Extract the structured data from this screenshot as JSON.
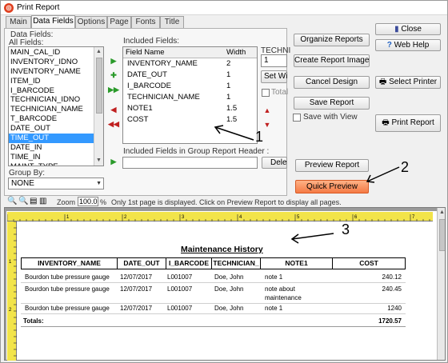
{
  "window": {
    "title": "Print Report"
  },
  "tabs": [
    {
      "label": "Main"
    },
    {
      "label": "Data Fields"
    },
    {
      "label": "Options"
    },
    {
      "label": "Page"
    },
    {
      "label": "Fonts"
    },
    {
      "label": "Title"
    }
  ],
  "data_fields": {
    "group_label": "Data Fields:",
    "all_fields_label": "All Fields:",
    "all_fields": [
      "MAIN_CAL_ID",
      "INVENTORY_IDNO",
      "INVENTORY_NAME",
      "ITEM_ID",
      "I_BARCODE",
      "TECHNICIAN_IDNO",
      "TECHNICIAN_NAME",
      "T_BARCODE",
      "DATE_OUT",
      "TIME_OUT",
      "DATE_IN",
      "TIME_IN",
      "MAINT_TYPE"
    ],
    "selected_field": "TIME_OUT",
    "included_fields_label": "Included Fields:",
    "included_columns": [
      "Field Name",
      "Width"
    ],
    "included_fields": [
      {
        "name": "INVENTORY_NAME",
        "width": "2"
      },
      {
        "name": "DATE_OUT",
        "width": "1"
      },
      {
        "name": "I_BARCODE",
        "width": "1"
      },
      {
        "name": "TECHNICIAN_NAME",
        "width": "1"
      },
      {
        "name": "NOTE1",
        "width": "1.5"
      },
      {
        "name": "COST",
        "width": "1.5"
      }
    ],
    "technician_label": "TECHNI",
    "technician_value": "1",
    "set_width_label": "Set Wi",
    "totals_label": "Total",
    "group_header_label": "Included Fields in Group Report Header :",
    "delete_label": "Dele",
    "group_by_label": "Group By:",
    "group_by_value": "NONE"
  },
  "buttons": {
    "organize": "Organize Reports",
    "create_image": "Create Report Image",
    "cancel_design": "Cancel Design",
    "save_report": "Save Report",
    "save_with_view": "Save with View",
    "close": "Close",
    "web_help": "Web Help",
    "select_printer": "Select Printer",
    "print_report": "Print Report",
    "preview_report": "Preview Report",
    "quick_preview": "Quick Preview"
  },
  "annotations": {
    "n1": "1",
    "n2": "2",
    "n3": "3"
  },
  "zoom_bar": {
    "zoom_label": "Zoom",
    "zoom_value": "100.0",
    "percent": "%",
    "hint": "Only 1st page is displayed. Click on Preview Report to display all pages."
  },
  "report": {
    "title": "Maintenance History",
    "columns": [
      "INVENTORY_NAME",
      "DATE_OUT",
      "I_BARCODE",
      "TECHNICIAN_",
      "NOTE1",
      "COST"
    ],
    "rows": [
      {
        "inventory": "Bourdon tube pressure gauge",
        "date": "12/07/2017",
        "barcode": "L001007",
        "tech": "Doe, John",
        "note": "note 1",
        "note2": "",
        "cost": "240.12"
      },
      {
        "inventory": "Bourdon tube pressure gauge",
        "date": "12/07/2017",
        "barcode": "L001007",
        "tech": "Doe, John",
        "note": "note  about",
        "note2": "maintenance",
        "cost": "240.45"
      },
      {
        "inventory": "Bourdon tube pressure gauge",
        "date": "12/07/2017",
        "barcode": "L001007",
        "tech": "Doe, John",
        "note": "note 1",
        "note2": "",
        "cost": "1240"
      }
    ],
    "totals_label": "Totals:",
    "totals_value": "1720.57"
  },
  "ruler": {
    "h_numbers": [
      "1",
      "2",
      "3",
      "4",
      "5",
      "6",
      "7"
    ],
    "v_numbers": [
      "1",
      "2"
    ]
  },
  "colors": {
    "accent_orange": "#f57a45",
    "selection_blue": "#3399ff",
    "ruler_yellow": "#f2e44a"
  }
}
